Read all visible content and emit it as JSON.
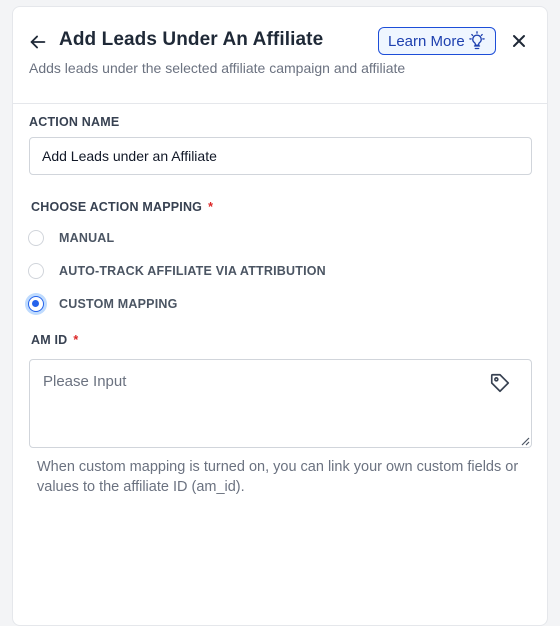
{
  "header": {
    "title": "Add Leads Under An Affiliate",
    "subtitle": "Adds leads under the selected affiliate campaign and affiliate",
    "learn_more_label": "Learn More",
    "back_icon": "arrow-left-icon",
    "close_icon": "close-icon",
    "learn_more_icon": "lightbulb-icon"
  },
  "action_name": {
    "label": "ACTION NAME",
    "value": "Add Leads under an Affiliate"
  },
  "mapping": {
    "label": "CHOOSE ACTION MAPPING",
    "required_mark": "*",
    "options": [
      {
        "label": "MANUAL",
        "selected": false
      },
      {
        "label": "AUTO-TRACK AFFILIATE VIA ATTRIBUTION",
        "selected": false
      },
      {
        "label": "CUSTOM MAPPING",
        "selected": true
      }
    ]
  },
  "am_id": {
    "label": "AM ID",
    "required_mark": "*",
    "placeholder": "Please Input",
    "icon": "tag-icon",
    "helper": "When custom mapping is turned on, you can link your own custom fields or values to the affiliate ID (am_id)."
  },
  "colors": {
    "accent": "#2563eb",
    "required": "#dc2626",
    "text": "#1f2937",
    "muted": "#6b7280"
  }
}
